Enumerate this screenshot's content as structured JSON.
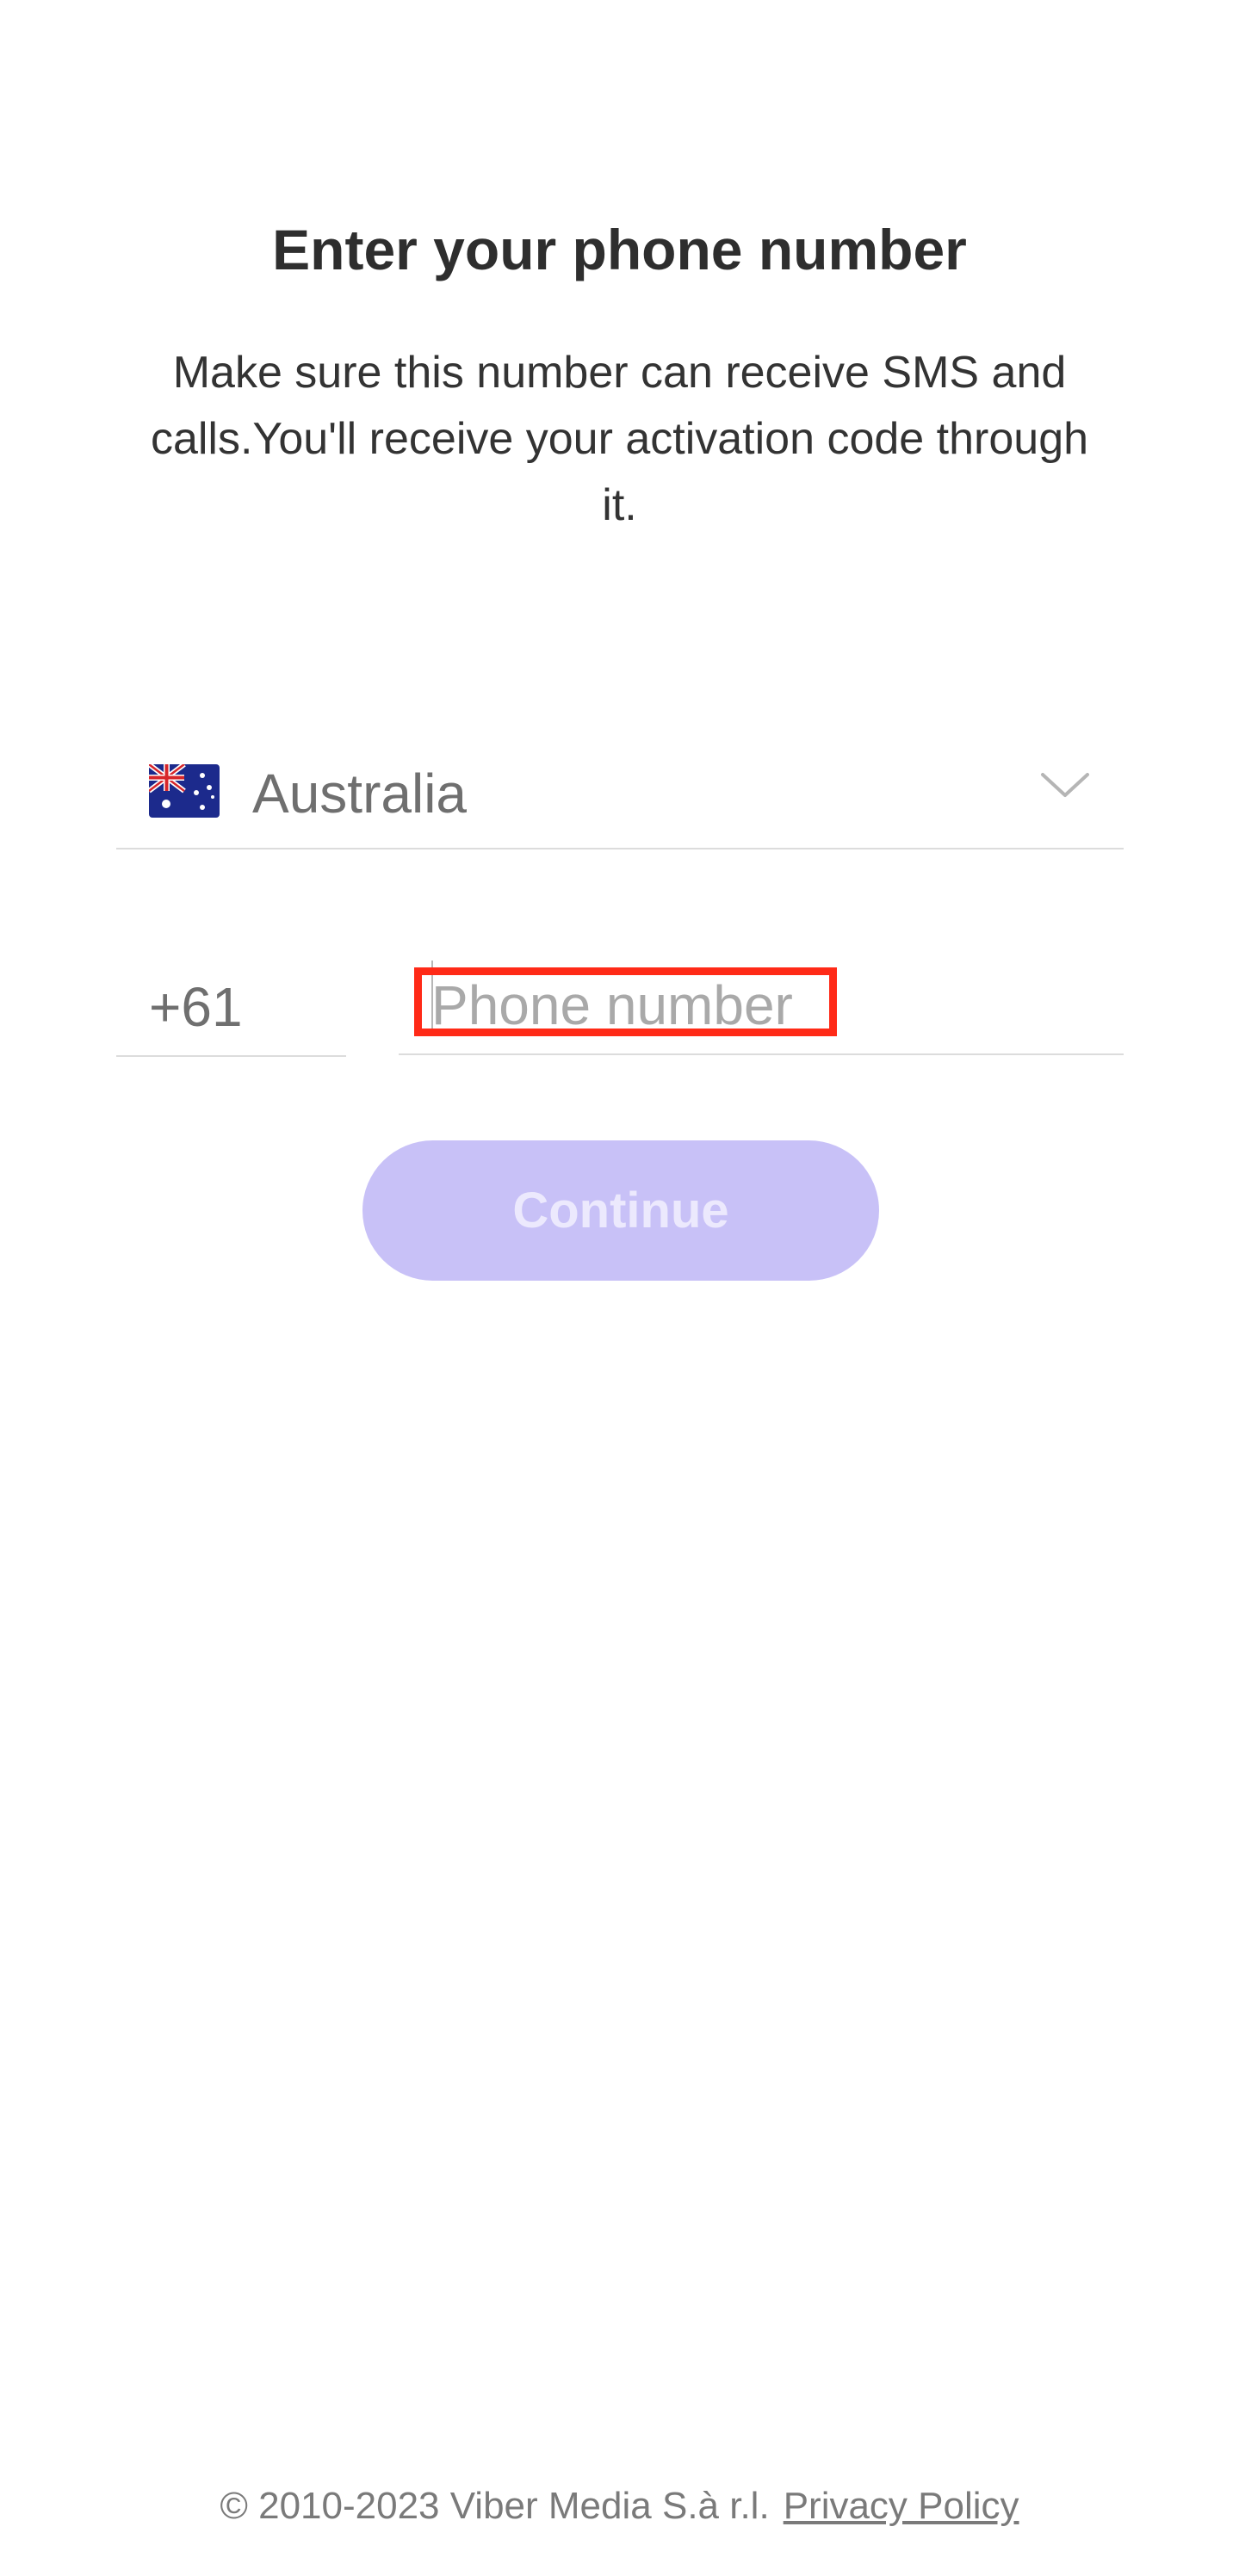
{
  "header": {
    "title": "Enter your phone number",
    "subtitle": "Make sure this number can receive SMS and calls.You'll receive your activation code through it."
  },
  "country_selector": {
    "flag_icon": "australia-flag-icon",
    "selected_country": "Australia",
    "dropdown_icon": "chevron-down-icon"
  },
  "phone": {
    "country_code": "+61",
    "value": "",
    "placeholder": "Phone number"
  },
  "actions": {
    "continue_label": "Continue",
    "continue_enabled": false
  },
  "footer": {
    "copyright": "© 2010-2023 Viber Media S.à r.l.",
    "privacy_link": "Privacy Policy"
  },
  "colors": {
    "button_disabled_bg": "#c8c1f7",
    "button_disabled_text": "#ece9fd",
    "highlight": "#ff2a17",
    "divider": "#dcdcdc"
  }
}
